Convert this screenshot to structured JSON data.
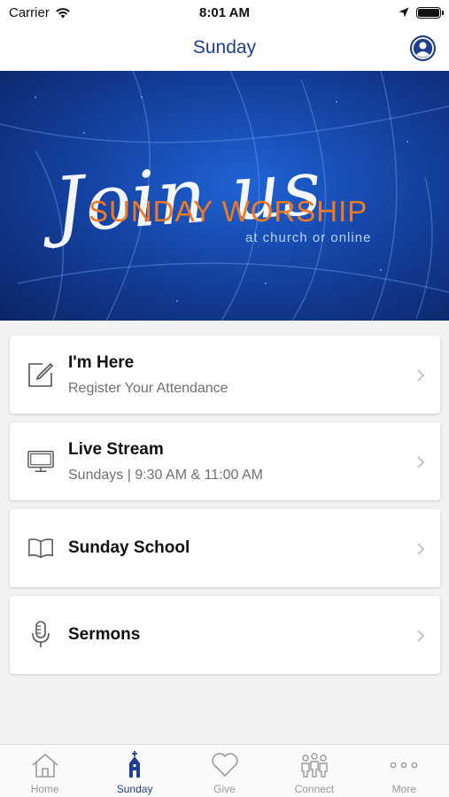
{
  "status_bar": {
    "carrier": "Carrier",
    "time": "8:01 AM",
    "icons": [
      "wifi-icon",
      "location-arrow-icon",
      "battery-icon"
    ]
  },
  "nav": {
    "title": "Sunday",
    "profile_icon": "user-circle-icon"
  },
  "banner": {
    "script_text": "Join us",
    "headline": "SUNDAY WORSHIP",
    "subline": "at church or online",
    "colors": {
      "headline": "#f07a23",
      "background": "#1a4fb8"
    }
  },
  "cards": [
    {
      "title": "I'm Here",
      "subtitle": "Register Your Attendance",
      "icon": "edit-note-icon"
    },
    {
      "title": "Live Stream",
      "subtitle": "Sundays | 9:30 AM & 11:00 AM",
      "icon": "monitor-icon"
    },
    {
      "title": "Sunday School",
      "subtitle": "",
      "icon": "open-book-icon"
    },
    {
      "title": "Sermons",
      "subtitle": "",
      "icon": "microphone-icon"
    }
  ],
  "tabs": [
    {
      "label": "Home",
      "icon": "house-icon",
      "active": false
    },
    {
      "label": "Sunday",
      "icon": "church-icon",
      "active": true
    },
    {
      "label": "Give",
      "icon": "heart-icon",
      "active": false
    },
    {
      "label": "Connect",
      "icon": "people-icon",
      "active": false
    },
    {
      "label": "More",
      "icon": "more-dots-icon",
      "active": false
    }
  ],
  "colors": {
    "accent": "#1e3f8e",
    "inactive": "#9a9a9a",
    "background": "#f2f2f4"
  }
}
